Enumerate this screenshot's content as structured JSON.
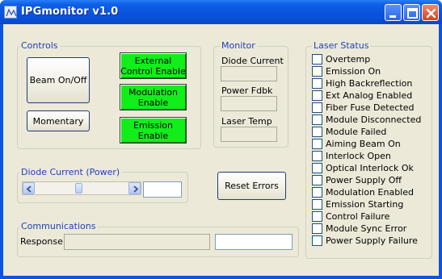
{
  "window": {
    "title": "IPGmonitor v1.0"
  },
  "controls": {
    "legend": "Controls",
    "beam_button": "Beam On/Off",
    "momentary_button": "Momentary",
    "external_control_button": "External\nControl Enable",
    "modulation_button": "Modulation\nEnable",
    "emission_button": "Emission\nEnable"
  },
  "monitor": {
    "legend": "Monitor",
    "diode_current_label": "Diode Current",
    "power_fdbk_label": "Power Fdbk",
    "laser_temp_label": "Laser Temp"
  },
  "diode_current_power": {
    "legend": "Diode Current (Power)",
    "value": ""
  },
  "reset_errors_button": "Reset Errors",
  "communications": {
    "legend": "Communications",
    "response_label": "Response"
  },
  "laser_status": {
    "legend": "Laser Status",
    "items": [
      "Overtemp",
      "Emission On",
      "High Backreflection",
      "Ext Analog Enabled",
      "Fiber Fuse Detected",
      "Module Disconnected",
      "Module Failed",
      "Aiming Beam On",
      "Interlock Open",
      "Optical Interlock Ok",
      "Power Supply Off",
      "Modulation Enabled",
      "Emission Starting",
      "Control Failure",
      "Module Sync Error",
      "Power Supply Failure"
    ]
  },
  "colors": {
    "title_bar": "#0a53dc",
    "face": "#ece9d8",
    "group_label": "#1f3fb8",
    "enable_button": "#11ee1a"
  }
}
